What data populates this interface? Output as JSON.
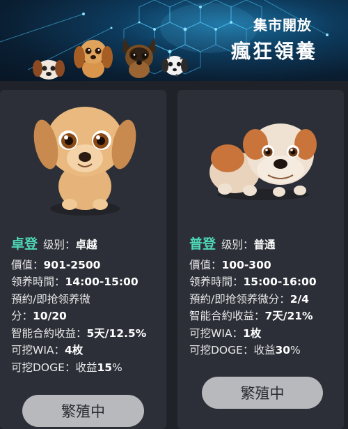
{
  "banner": {
    "line1": "集市開放",
    "line2": "瘋狂領養"
  },
  "pets": [
    {
      "name": "卓登",
      "level_label": "级别：",
      "level": "卓越",
      "price_label": "價值：",
      "price": "901-2500",
      "time_label": "领养時間：",
      "time": "14:00-15:00",
      "points_label_1": "預約/即抢领养微",
      "points_label_2": "分：",
      "points": "10/20",
      "income_label": "智能合約收益：",
      "income": "5天/12.5%",
      "wia_label": "可挖WIA：",
      "wia": "4枚",
      "doge_label": "可挖DOGE：收益",
      "doge": "15",
      "doge_unit": "%",
      "button": "繁殖中"
    },
    {
      "name": "普登",
      "level_label": "级别：",
      "level": "普通",
      "price_label": "價值：",
      "price": "100-300",
      "time_label": "领养時間：",
      "time": "15:00-16:00",
      "points_label": "預約/即抢领养微分：",
      "points": "2/4",
      "income_label": "智能合約收益：",
      "income": "7天/21%",
      "wia_label": "可挖WIA：",
      "wia": "1枚",
      "doge_label": "可挖DOGE：收益",
      "doge": "30",
      "doge_unit": "%",
      "button": "繁殖中"
    }
  ],
  "colors": {
    "accent_name": "#4ed7b7",
    "card_bg": "#2c2f37",
    "page_bg": "#1f2228",
    "button_bg": "#b8b9bd"
  },
  "icons": [
    "puppy-illustration",
    "bulldog-illustration",
    "network-hexagon-pattern"
  ]
}
